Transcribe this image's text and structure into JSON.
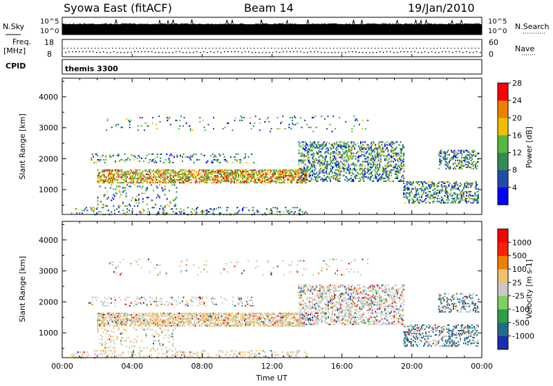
{
  "header": {
    "title": "Syowa East (fitACF)",
    "beam": "Beam 14",
    "date": "19/Jan/2010"
  },
  "strip_noise": {
    "left_label": "N.Sky",
    "right_label": "N.Search",
    "tick_top": "10^5",
    "tick_bottom": "10^0"
  },
  "strip_freq": {
    "left_label_1": "Freq.",
    "left_label_2": "[MHz]",
    "right_label": "Nave",
    "left_ticks": [
      "18",
      "8"
    ],
    "right_ticks": [
      "60",
      "0"
    ]
  },
  "cpid": {
    "label": "CPID",
    "value": "themis 3300"
  },
  "chart_data": [
    {
      "type": "heatmap",
      "name": "power",
      "ylabel": "Slant Range [km]",
      "ylim": [
        200,
        4600
      ],
      "yticks": [
        1000,
        2000,
        3000,
        4000
      ],
      "x_tick_labels": [
        "00:00",
        "04:00",
        "08:00",
        "12:00",
        "16:00",
        "20:00",
        "00:00"
      ],
      "colorbar": {
        "label": "Power [dB]",
        "ticks": [
          "4",
          "8",
          "12",
          "16",
          "20",
          "24",
          "28"
        ],
        "colors": [
          "#0000ff",
          "#1f4ea8",
          "#2f8e4f",
          "#56b840",
          "#f0c000",
          "#f08000",
          "#ff0000"
        ]
      }
    },
    {
      "type": "heatmap",
      "name": "velocity",
      "ylabel": "Slant Range [km]",
      "ylim": [
        200,
        4600
      ],
      "yticks": [
        1000,
        2000,
        3000,
        4000
      ],
      "x_tick_labels": [
        "00:00",
        "04:00",
        "08:00",
        "12:00",
        "16:00",
        "20:00",
        "00:00"
      ],
      "xlabel": "Time UT",
      "colorbar": {
        "label": "Velocity [m s-1]",
        "ticks": [
          "1000",
          "500",
          "100",
          "25",
          "-25",
          "-100",
          "-500",
          "-1000"
        ],
        "colors": [
          "#1a2fb0",
          "#1f6e8c",
          "#2e9e4a",
          "#7fd060",
          "#c8c8c8",
          "#f0c070",
          "#f08000",
          "#ff2000",
          "#ff0000"
        ]
      }
    }
  ]
}
